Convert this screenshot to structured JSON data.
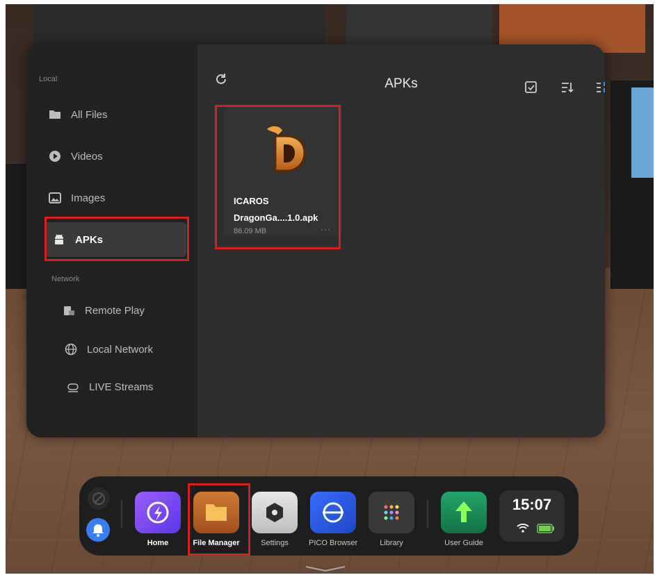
{
  "sidebar": {
    "local_label": "Local",
    "network_label": "Network",
    "local_items": [
      {
        "label": "All Files",
        "icon": "folder-icon"
      },
      {
        "label": "Videos",
        "icon": "play-icon"
      },
      {
        "label": "Images",
        "icon": "image-icon"
      },
      {
        "label": "APKs",
        "icon": "android-icon",
        "active": true
      }
    ],
    "network_items": [
      {
        "label": "Remote Play",
        "icon": "remote-play-icon"
      },
      {
        "label": "Local Network",
        "icon": "globe-icon"
      },
      {
        "label": "LIVE Streams",
        "icon": "live-icon"
      }
    ]
  },
  "content": {
    "title": "APKs",
    "file": {
      "name_line1": "ICAROS",
      "name_line2": "DragonGa....1.0.apk",
      "size": "86.09 MB",
      "more": "···"
    }
  },
  "dock": {
    "items": [
      {
        "label": "Home",
        "icon": "home-compass-icon",
        "color": "#7b4dff"
      },
      {
        "label": "File Manager",
        "icon": "folder-icon",
        "color": "#c4682a"
      },
      {
        "label": "Settings",
        "icon": "hexagon-settings-icon",
        "color": "#d8d8d8"
      },
      {
        "label": "PICO Browser",
        "icon": "browser-icon",
        "color": "#2f63e8"
      },
      {
        "label": "Library",
        "icon": "grid-icon",
        "color": "#3a3a3a"
      },
      {
        "label": "User Guide",
        "icon": "arrow-up-icon",
        "color": "#1e8a58"
      }
    ],
    "time": "15:07"
  },
  "colors": {
    "highlight": "#d62020",
    "panel": "#2d2d2d",
    "sidebar": "#222222"
  }
}
